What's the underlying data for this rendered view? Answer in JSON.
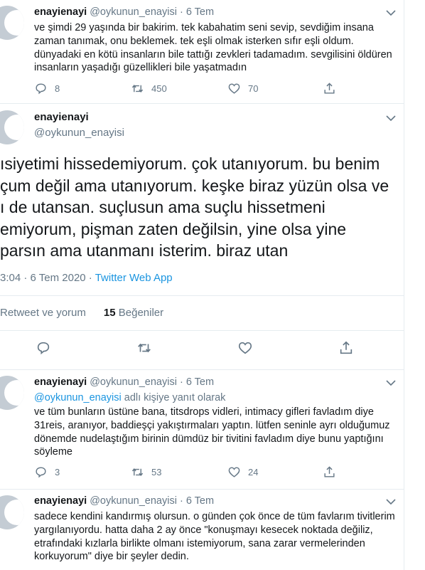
{
  "tweet1": {
    "name": "enayienayi",
    "handle": "@oykunun_enayisi",
    "time": "6 Tem",
    "text": "ve şimdi 29 yaşında bir bakirim. tek kabahatim seni sevip, sevdiğim insana zaman tanımak, onu beklemek. tek eşli olmak isterken sıfır eşli oldum. dünyadaki en kötü insanların bile tattığı zevkleri tadamadım. sevgilisini öldüren insanların yaşadığı güzellikleri bile yaşatmadın",
    "replies": "8",
    "retweets": "450",
    "likes": "70"
  },
  "main": {
    "name": "enayienayi",
    "handle": "@oykunun_enayisi",
    "lines": [
      "ısiyetimi hissedemiyorum. çok utanıyorum. bu benim",
      "çum değil ama utanıyorum. keşke biraz yüzün olsa ve",
      "ı de utansan. suçlusun ama suçlu hissetmeni",
      "emiyorum, pişman zaten değilsin, yine olsa yine",
      "parsın ama utanmanı isterim. biraz utan"
    ],
    "time": "3:04 · 6 Tem 2020 · ",
    "source": "Twitter Web App",
    "retweet_label": "Retweet ve yorum",
    "likes_count": "15",
    "likes_label": "Beğeniler"
  },
  "tweet2": {
    "name": "enayienayi",
    "handle": "@oykunun_enayisi",
    "time": "6 Tem",
    "reply_to": "@oykunun_enayisi",
    "reply_suffix": " adlı kişiye yanıt olarak",
    "text": "ve tüm bunların üstüne bana, titsdrops vidleri, intimacy gifleri favladım diye 31reis, aranıyor, baddieşçi yakıştırmaları yaptın. lütfen seninle ayrı olduğumuz dönemde nudelaştığım birinin dümdüz bir tivitini favladım diye bunu yaptığını söyleme",
    "replies": "3",
    "retweets": "53",
    "likes": "24"
  },
  "tweet3": {
    "name": "enayienayi",
    "handle": "@oykunun_enayisi",
    "time": "6 Tem",
    "text": "sadece kendini kandırmış olursun. o günden çok önce de tüm favlarım tivitlerim yargılanıyordu. hatta daha 2 ay önce \"konuşmayı kesecek noktada değiliz, etrafındaki kızlarla birlikte olmanı istemiyorum, sana zarar vermelerinden korkuyorum\" diye bir şeyler dedin."
  },
  "separator": " · ",
  "icons": [
    "reply-icon",
    "retweet-icon",
    "like-icon",
    "share-icon",
    "chevron-down-icon"
  ],
  "colors": {
    "link": "#1b95e0",
    "secondary": "#657786",
    "border": "#e6ecf0"
  }
}
